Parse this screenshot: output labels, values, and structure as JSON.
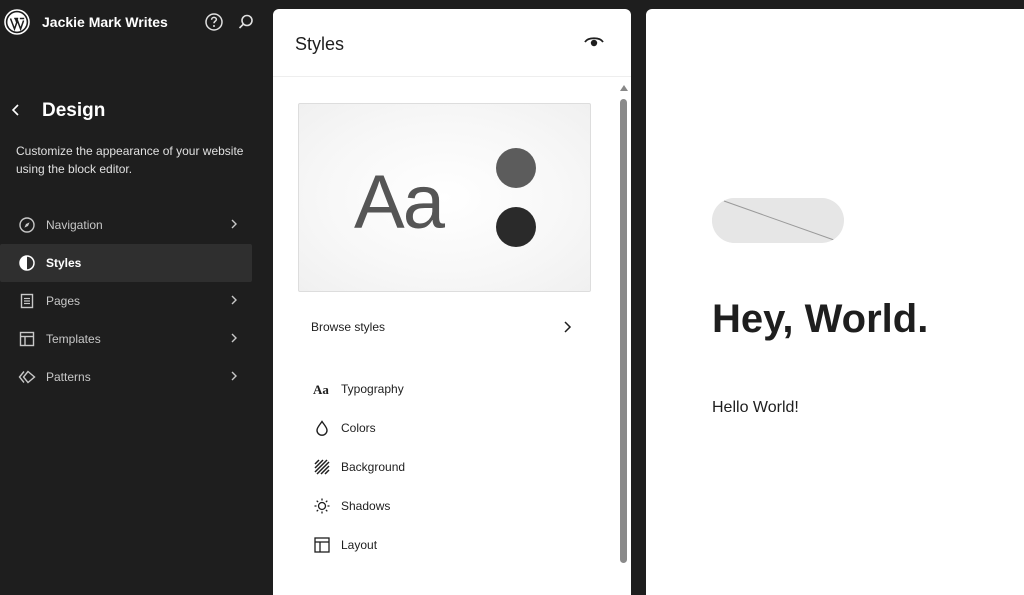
{
  "app": {
    "site_title": "Jackie Mark Writes",
    "icons": {
      "logo": "wordpress-logo-icon",
      "help": "help-icon",
      "search": "search-icon"
    }
  },
  "sidebar": {
    "title": "Design",
    "description": "Customize the appearance of your website using the block editor.",
    "items": [
      {
        "label": "Navigation",
        "icon": "navigation-compass-icon",
        "active": false,
        "has_chevron": true
      },
      {
        "label": "Styles",
        "icon": "styles-half-circle-icon",
        "active": true,
        "has_chevron": false
      },
      {
        "label": "Pages",
        "icon": "pages-icon",
        "active": false,
        "has_chevron": true
      },
      {
        "label": "Templates",
        "icon": "templates-layout-icon",
        "active": false,
        "has_chevron": true
      },
      {
        "label": "Patterns",
        "icon": "patterns-diamond-icon",
        "active": false,
        "has_chevron": true
      }
    ]
  },
  "styles_panel": {
    "title": "Styles",
    "preview": {
      "sample_text": "Aa",
      "swatch_colors": [
        "#5c5c5c",
        "#2a2a2a"
      ]
    },
    "browse_label": "Browse styles",
    "menu": [
      {
        "label": "Typography",
        "icon": "typography-icon"
      },
      {
        "label": "Colors",
        "icon": "droplet-icon"
      },
      {
        "label": "Background",
        "icon": "background-icon"
      },
      {
        "label": "Shadows",
        "icon": "shadows-sun-icon"
      },
      {
        "label": "Layout",
        "icon": "layout-icon"
      }
    ]
  },
  "canvas": {
    "heading": "Hey, World.",
    "paragraph": "Hello World!"
  },
  "colors": {
    "sidebar_bg": "#1e1e1e",
    "active_item_bg": "#2f2f2f",
    "panel_bg": "#ffffff",
    "text_dark": "#1e1e1e"
  }
}
